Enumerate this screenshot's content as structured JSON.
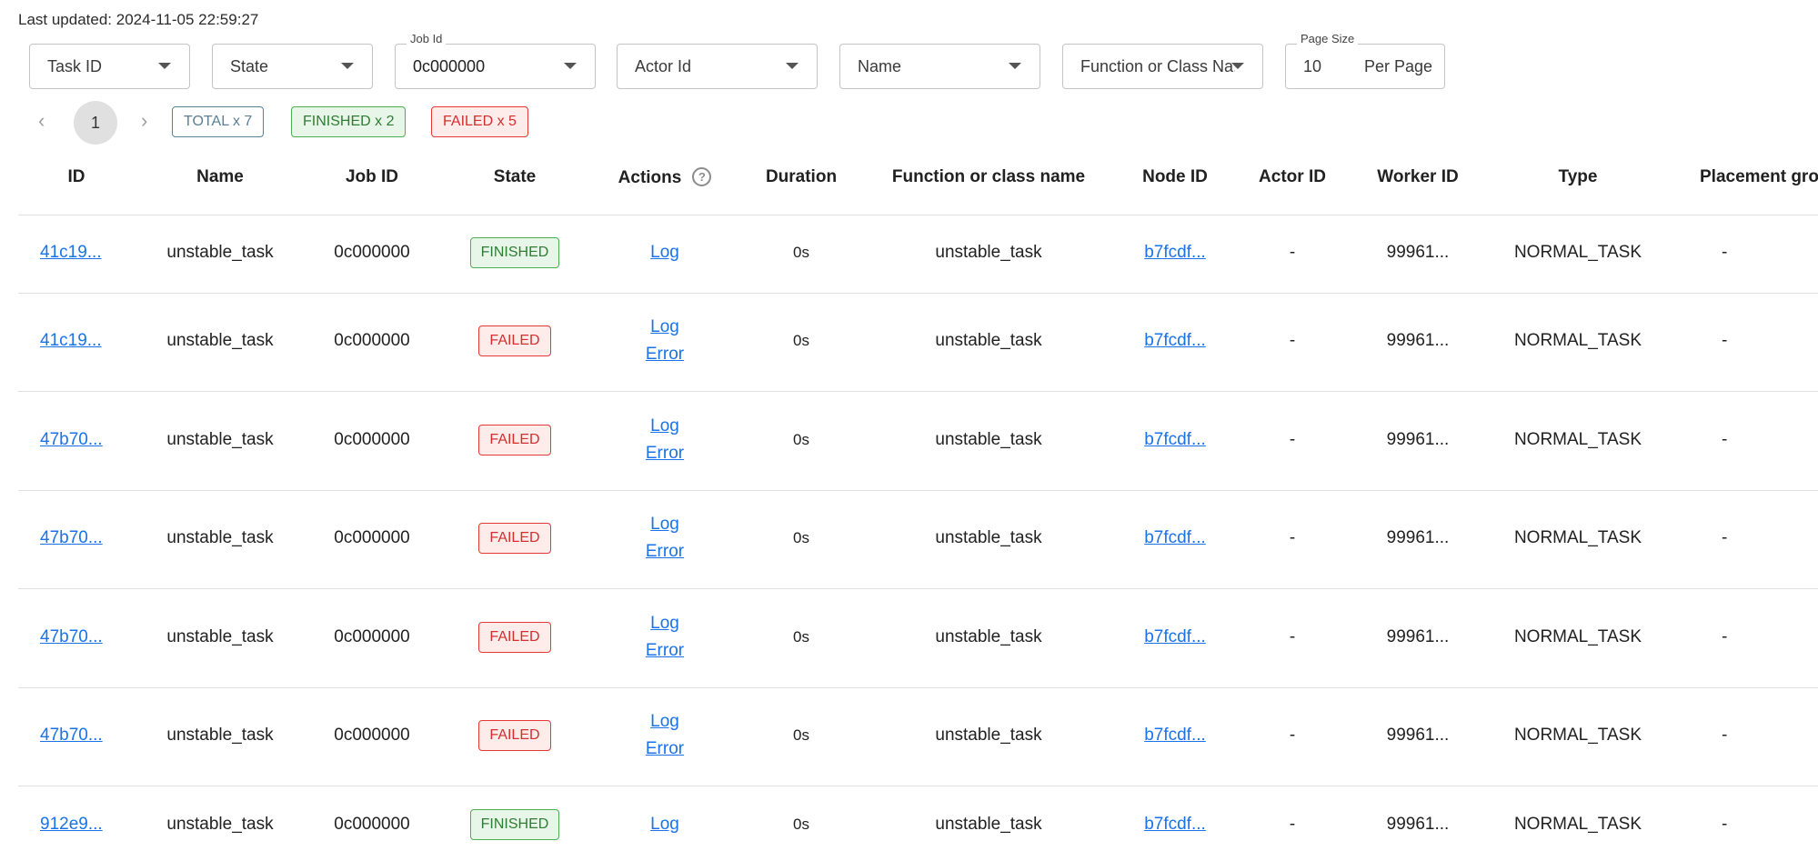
{
  "last_updated": "Last updated: 2024-11-05 22:59:27",
  "filters": {
    "task_id": {
      "value": "Task ID"
    },
    "state": {
      "value": "State"
    },
    "job_id": {
      "label": "Job Id",
      "value": "0c000000"
    },
    "actor_id": {
      "value": "Actor Id"
    },
    "name": {
      "value": "Name"
    },
    "function_or_class_name": {
      "value": "Function or Class Na..."
    },
    "page_size": {
      "label": "Page Size",
      "value": "10",
      "suffix": "Per Page"
    }
  },
  "pagination": {
    "prev": "‹",
    "current": "1",
    "next": "›"
  },
  "summary": {
    "total": "TOTAL x 7",
    "finished": "FINISHED x 2",
    "failed": "FAILED x 5"
  },
  "icons": {
    "help": "help-circle-icon",
    "prev": "chevron-left-icon",
    "next": "chevron-right-icon",
    "dropdown": "caret-down-icon"
  },
  "colors": {
    "link": "#1a73e8",
    "finished": "#2e7d32",
    "failed": "#d32f2f",
    "total": "#5c7f94"
  },
  "table": {
    "headers": [
      "ID",
      "Name",
      "Job ID",
      "State",
      "Actions",
      "Duration",
      "Function or class name",
      "Node ID",
      "Actor ID",
      "Worker ID",
      "Type",
      "Placement gro"
    ],
    "rows": [
      {
        "id": "41c19...",
        "name": "unstable_task",
        "job_id": "0c000000",
        "state": "FINISHED",
        "actions": [
          "Log"
        ],
        "duration": "0s",
        "func": "unstable_task",
        "node_id": "b7fcdf...",
        "actor_id": "-",
        "worker_id": "99961...",
        "type": "NORMAL_TASK",
        "placement": "-"
      },
      {
        "id": "41c19...",
        "name": "unstable_task",
        "job_id": "0c000000",
        "state": "FAILED",
        "actions": [
          "Log",
          "Error"
        ],
        "duration": "0s",
        "func": "unstable_task",
        "node_id": "b7fcdf...",
        "actor_id": "-",
        "worker_id": "99961...",
        "type": "NORMAL_TASK",
        "placement": "-"
      },
      {
        "id": "47b70...",
        "name": "unstable_task",
        "job_id": "0c000000",
        "state": "FAILED",
        "actions": [
          "Log",
          "Error"
        ],
        "duration": "0s",
        "func": "unstable_task",
        "node_id": "b7fcdf...",
        "actor_id": "-",
        "worker_id": "99961...",
        "type": "NORMAL_TASK",
        "placement": "-"
      },
      {
        "id": "47b70...",
        "name": "unstable_task",
        "job_id": "0c000000",
        "state": "FAILED",
        "actions": [
          "Log",
          "Error"
        ],
        "duration": "0s",
        "func": "unstable_task",
        "node_id": "b7fcdf...",
        "actor_id": "-",
        "worker_id": "99961...",
        "type": "NORMAL_TASK",
        "placement": "-"
      },
      {
        "id": "47b70...",
        "name": "unstable_task",
        "job_id": "0c000000",
        "state": "FAILED",
        "actions": [
          "Log",
          "Error"
        ],
        "duration": "0s",
        "func": "unstable_task",
        "node_id": "b7fcdf...",
        "actor_id": "-",
        "worker_id": "99961...",
        "type": "NORMAL_TASK",
        "placement": "-"
      },
      {
        "id": "47b70...",
        "name": "unstable_task",
        "job_id": "0c000000",
        "state": "FAILED",
        "actions": [
          "Log",
          "Error"
        ],
        "duration": "0s",
        "func": "unstable_task",
        "node_id": "b7fcdf...",
        "actor_id": "-",
        "worker_id": "99961...",
        "type": "NORMAL_TASK",
        "placement": "-"
      },
      {
        "id": "912e9...",
        "name": "unstable_task",
        "job_id": "0c000000",
        "state": "FINISHED",
        "actions": [
          "Log"
        ],
        "duration": "0s",
        "func": "unstable_task",
        "node_id": "b7fcdf...",
        "actor_id": "-",
        "worker_id": "99961...",
        "type": "NORMAL_TASK",
        "placement": "-"
      }
    ]
  }
}
